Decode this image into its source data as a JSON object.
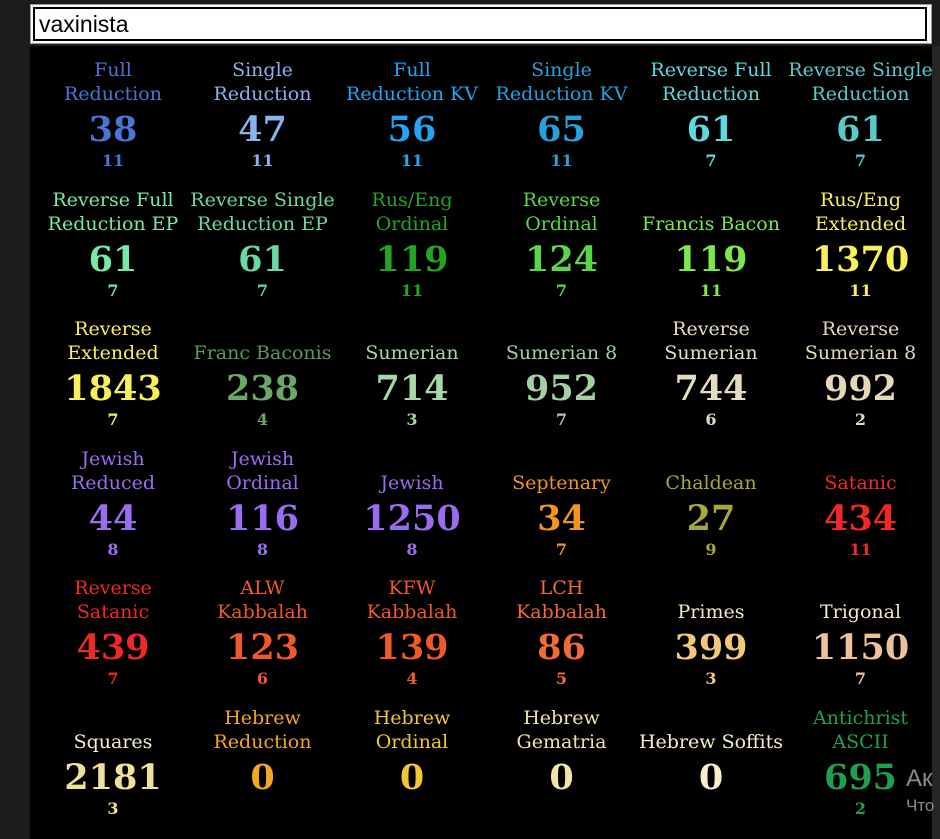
{
  "search": {
    "value": "vaxinista"
  },
  "ciphers": [
    {
      "name": "Full\nReduction",
      "value": "38",
      "reduction": "11",
      "color": "#4a74d2",
      "num_color": "#4a74d2"
    },
    {
      "name": "Single\nReduction",
      "value": "47",
      "reduction": "11",
      "color": "#8ab2ee",
      "num_color": "#8ab2ee"
    },
    {
      "name": "Full\nReduction KV",
      "value": "56",
      "reduction": "11",
      "color": "#23a4f0",
      "num_color": "#23a4f0"
    },
    {
      "name": "Single\nReduction KV",
      "value": "65",
      "reduction": "11",
      "color": "#2aa0d8",
      "num_color": "#2aa0d8"
    },
    {
      "name": "Reverse Full\nReduction",
      "value": "61",
      "reduction": "7",
      "color": "#5fd8de",
      "num_color": "#5fd8de"
    },
    {
      "name": "Reverse Single\nReduction",
      "value": "61",
      "reduction": "7",
      "color": "#5cc8c8",
      "num_color": "#5cc8c8"
    },
    {
      "name": "Reverse Full\nReduction EP",
      "value": "61",
      "reduction": "7",
      "color": "#78e8a8",
      "num_color": "#78e8a8"
    },
    {
      "name": "Reverse Single\nReduction EP",
      "value": "61",
      "reduction": "7",
      "color": "#6ad8a0",
      "num_color": "#6ad8a0"
    },
    {
      "name": "Rus/Eng\nOrdinal",
      "value": "119",
      "reduction": "11",
      "color": "#23a523",
      "num_color": "#23a523"
    },
    {
      "name": "Reverse\nOrdinal",
      "value": "124",
      "reduction": "7",
      "color": "#58d848",
      "num_color": "#58d848"
    },
    {
      "name": "Francis Bacon",
      "value": "119",
      "reduction": "11",
      "color": "#7ee84a",
      "num_color": "#7ee84a"
    },
    {
      "name": "Rus/Eng\nExtended",
      "value": "1370",
      "reduction": "11",
      "color": "#f8f05a",
      "num_color": "#f8f05a"
    },
    {
      "name": "Reverse\nExtended",
      "value": "1843",
      "reduction": "7",
      "color": "#f8f05a",
      "num_color": "#f8f05a"
    },
    {
      "name": "Franc Baconis",
      "value": "238",
      "reduction": "4",
      "color": "#5a9a5a",
      "num_color": "#6aa86a"
    },
    {
      "name": "Sumerian",
      "value": "714",
      "reduction": "3",
      "color": "#a8d8a8",
      "num_color": "#a8d8a8"
    },
    {
      "name": "Sumerian 8",
      "value": "952",
      "reduction": "7",
      "color": "#a4d0a4",
      "num_color": "#a4d0a4"
    },
    {
      "name": "Reverse\nSumerian",
      "value": "744",
      "reduction": "6",
      "color": "#e4dcc0",
      "num_color": "#e4dcc0"
    },
    {
      "name": "Reverse\nSumerian 8",
      "value": "992",
      "reduction": "2",
      "color": "#e4d8b8",
      "num_color": "#e4d8b8"
    },
    {
      "name": "Jewish\nReduced",
      "value": "44",
      "reduction": "8",
      "color": "#9a6cf0",
      "num_color": "#9a6cf0"
    },
    {
      "name": "Jewish\nOrdinal",
      "value": "116",
      "reduction": "8",
      "color": "#9a6cf0",
      "num_color": "#9a6cf0"
    },
    {
      "name": "Jewish",
      "value": "1250",
      "reduction": "8",
      "color": "#9a6cf0",
      "num_color": "#9a6cf0"
    },
    {
      "name": "Septenary",
      "value": "34",
      "reduction": "7",
      "color": "#f0961e",
      "num_color": "#f0961e"
    },
    {
      "name": "Chaldean",
      "value": "27",
      "reduction": "9",
      "color": "#a8a83a",
      "num_color": "#a8a83a"
    },
    {
      "name": "Satanic",
      "value": "434",
      "reduction": "11",
      "color": "#f02828",
      "num_color": "#f02828"
    },
    {
      "name": "Reverse\nSatanic",
      "value": "439",
      "reduction": "7",
      "color": "#f02828",
      "num_color": "#f02828"
    },
    {
      "name": "ALW\nKabbalah",
      "value": "123",
      "reduction": "6",
      "color": "#f05a28",
      "num_color": "#f05a28"
    },
    {
      "name": "KFW\nKabbalah",
      "value": "139",
      "reduction": "4",
      "color": "#f05a28",
      "num_color": "#f05a28"
    },
    {
      "name": "LCH\nKabbalah",
      "value": "86",
      "reduction": "5",
      "color": "#f06a3a",
      "num_color": "#f06a3a"
    },
    {
      "name": "Primes",
      "value": "399",
      "reduction": "3",
      "color": "#f2e8c8",
      "num_color": "#f4c87a"
    },
    {
      "name": "Trigonal",
      "value": "1150",
      "reduction": "7",
      "color": "#f2e8c8",
      "num_color": "#ebc29a"
    },
    {
      "name": "Squares",
      "value": "2181",
      "reduction": "3",
      "color": "#f4eccc",
      "num_color": "#efe09a"
    },
    {
      "name": "Hebrew\nReduction",
      "value": "0",
      "reduction": "",
      "color": "#f5a623",
      "num_color": "#f5a623"
    },
    {
      "name": "Hebrew\nOrdinal",
      "value": "0",
      "reduction": "",
      "color": "#f2c830",
      "num_color": "#f2c830"
    },
    {
      "name": "Hebrew\nGematria",
      "value": "0",
      "reduction": "",
      "color": "#f2e4a8",
      "num_color": "#f2e4a8"
    },
    {
      "name": "Hebrew Soffits",
      "value": "0",
      "reduction": "",
      "color": "#f8f0cc",
      "num_color": "#f8f0cc"
    },
    {
      "name": "Antichrist\nASCII",
      "value": "695",
      "reduction": "2",
      "color": "#1ea050",
      "num_color": "#1ea050"
    }
  ],
  "overlay": {
    "title": "Ак",
    "subtitle": "Что"
  }
}
